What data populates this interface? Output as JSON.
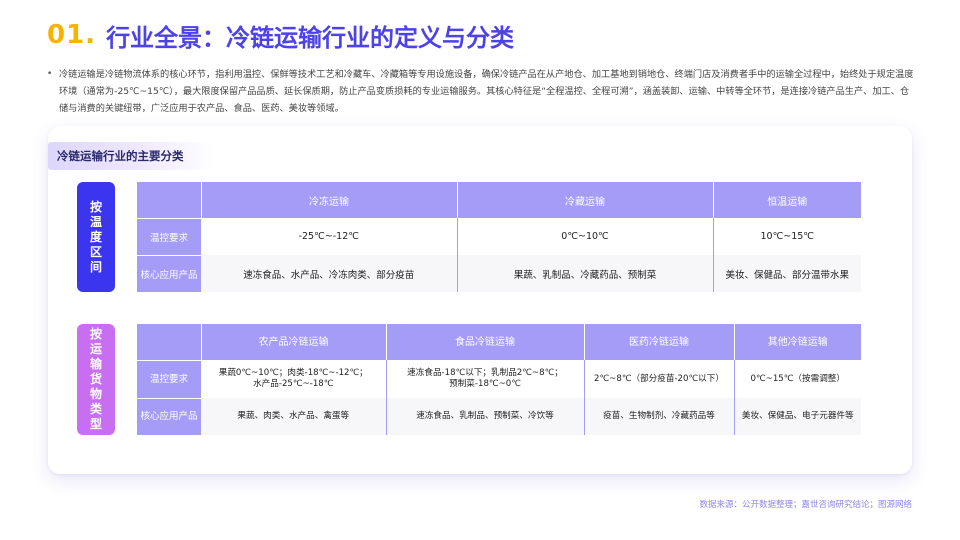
{
  "header": {
    "number": "01.",
    "title": "行业全景：冷链运输行业的定义与分类"
  },
  "intro": {
    "bullet": "•",
    "text": "冷链运输是冷链物流体系的核心环节，指利用温控、保鲜等技术工艺和冷藏车、冷藏箱等专用设施设备，确保冷链产品在从产地仓、加工基地到销地仓、终端门店及消费者手中的运输全过程中，始终处于规定温度环境（通常为-25℃~15℃），最大限度保留产品品质、延长保质期，防止产品变质损耗的专业运输服务。其核心特征是“全程温控、全程可溯”，涵盖装卸、运输、中转等全环节，是连接冷链产品生产、加工、仓储与消费的关键纽带，广泛应用于农产品、食品、医药、美妆等领域。"
  },
  "section": {
    "title": "冷链运输行业的主要分类"
  },
  "by_temperature": {
    "label": [
      "按",
      "温",
      "度",
      "区",
      "间"
    ],
    "columns": [
      "冷冻运输",
      "冷藏运输",
      "恒温运输"
    ],
    "rows": [
      {
        "header": "温控要求",
        "cells": [
          "-25℃~-12℃",
          "0℃~10℃",
          "10℃~15℃"
        ]
      },
      {
        "header": "核心应用产品",
        "cells": [
          "速冻食品、水产品、冷冻肉类、部分疫苗",
          "果蔬、乳制品、冷藏药品、预制菜",
          "美妆、保健品、部分温带水果"
        ]
      }
    ]
  },
  "by_goods": {
    "label": [
      "按",
      "运",
      "输",
      "货",
      "物",
      "类",
      "型"
    ],
    "columns": [
      "农产品冷链运输",
      "食品冷链运输",
      "医药冷链运输",
      "其他冷链运输"
    ],
    "rows": [
      {
        "header": "温控要求",
        "cells": [
          [
            "果蔬0℃~10℃；肉类-18℃~-12℃；",
            "水产品-25℃~-18℃"
          ],
          [
            "速冻食品-18℃以下；乳制品2℃~8℃；",
            "预制菜-18℃~0℃"
          ],
          [
            "2℃~8℃（部分疫苗-20℃以下）"
          ],
          [
            "0℃~15℃（按需调整）"
          ]
        ]
      },
      {
        "header": "核心应用产品",
        "cells": [
          [
            "果蔬、肉类、水产品、禽蛋等"
          ],
          [
            "速冻食品、乳制品、预制菜、冷饮等"
          ],
          [
            "疫苗、生物制剂、冷藏药品等"
          ],
          [
            "美妆、保健品、电子元器件等"
          ]
        ]
      }
    ]
  },
  "footer": {
    "source": "数据来源：公开数据整理；嘉世咨询研究结论；图源网络"
  },
  "colors": {
    "accent_yellow": "#f6b300",
    "title_purple": "#4d42e6",
    "table_header": "#a49cf6",
    "group1_blue": "#3b35f0",
    "group2_violet": "#c76ef1"
  }
}
